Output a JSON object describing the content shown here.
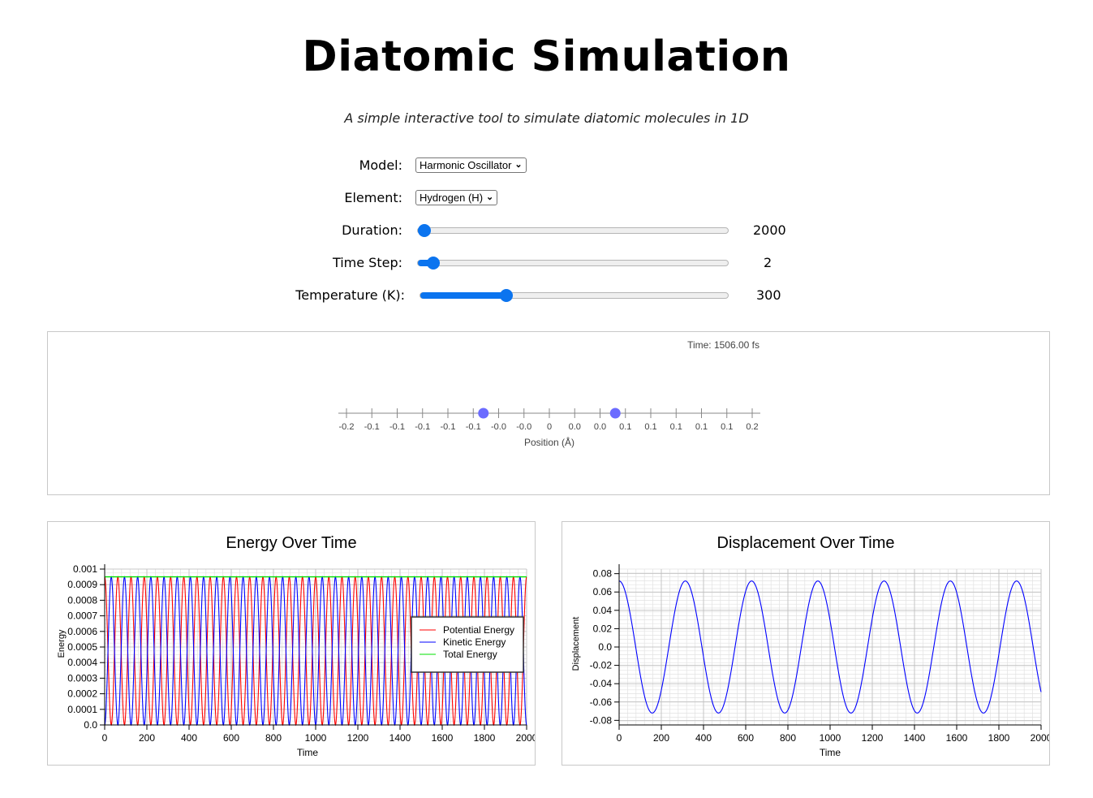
{
  "page": {
    "title": "Diatomic Simulation",
    "subtitle": "A simple interactive tool to simulate diatomic molecules in 1D"
  },
  "controls": {
    "model": {
      "label": "Model:",
      "value": "Harmonic Oscillator"
    },
    "element": {
      "label": "Element:",
      "value": "Hydrogen (H)"
    },
    "duration": {
      "label": "Duration:",
      "value": "2000",
      "fraction": 0.0
    },
    "time_step": {
      "label": "Time Step:",
      "value": "2",
      "fraction": 0.03
    },
    "temperature": {
      "label": "Temperature (K):",
      "value": "300",
      "fraction": 0.27
    }
  },
  "colors": {
    "accent": "#0b74ef",
    "atom": "#6b6bff",
    "potential": "#ff0000",
    "kinetic": "#0000ff",
    "total": "#00e000"
  },
  "simulation": {
    "time_label": "Time: 1506.00 fs",
    "axis_label": "Position (Å)",
    "ticks": [
      "-0.2",
      "-0.1",
      "-0.1",
      "-0.1",
      "-0.1",
      "-0.1",
      "-0.0",
      "-0.0",
      "0",
      "0.0",
      "0.0",
      "0.1",
      "0.1",
      "0.1",
      "0.1",
      "0.1",
      "0.2"
    ],
    "tick_values": [
      -0.2,
      -0.175,
      -0.15,
      -0.125,
      -0.1,
      -0.075,
      -0.05,
      -0.025,
      0,
      0.025,
      0.05,
      0.075,
      0.1,
      0.125,
      0.15,
      0.175,
      0.2
    ],
    "atom_positions": [
      -0.065,
      0.065
    ]
  },
  "chart_data": [
    {
      "type": "line",
      "title": "Energy Over Time",
      "xlabel": "Time",
      "ylabel": "Energy",
      "xlim": [
        0,
        2000
      ],
      "ylim": [
        0,
        0.001
      ],
      "xticks": [
        "0",
        "200",
        "400",
        "600",
        "800",
        "1000",
        "1200",
        "1400",
        "1600",
        "1800",
        "2000"
      ],
      "yticks": [
        "0.0",
        "0.0001",
        "0.0002",
        "0.0003",
        "0.0004",
        "0.0005",
        "0.0006",
        "0.0007",
        "0.0008",
        "0.0009",
        "0.001"
      ],
      "grid": true,
      "legend_position": "right",
      "series": [
        {
          "name": "Potential Energy",
          "amplitude": 0.00095,
          "cycles_per_2000": 32,
          "phase": "cos"
        },
        {
          "name": "Kinetic Energy",
          "amplitude": 0.00095,
          "cycles_per_2000": 32,
          "phase": "sin"
        },
        {
          "name": "Total Energy",
          "constant": 0.00095
        }
      ]
    },
    {
      "type": "line",
      "title": "Displacement Over Time",
      "xlabel": "Time",
      "ylabel": "Displacement",
      "xlim": [
        0,
        2000
      ],
      "ylim": [
        -0.085,
        0.085
      ],
      "xticks": [
        "0",
        "200",
        "400",
        "600",
        "800",
        "1000",
        "1200",
        "1400",
        "1600",
        "1800",
        "2000"
      ],
      "yticks": [
        "-0.08",
        "-0.06",
        "-0.04",
        "-0.02",
        "0.0",
        "0.02",
        "0.04",
        "0.06",
        "0.08"
      ],
      "ytick_values": [
        -0.08,
        -0.06,
        -0.04,
        -0.02,
        0,
        0.02,
        0.04,
        0.06,
        0.08
      ],
      "grid": true,
      "series": [
        {
          "amplitude": 0.072,
          "period": 314,
          "phase": "cos"
        }
      ]
    }
  ]
}
